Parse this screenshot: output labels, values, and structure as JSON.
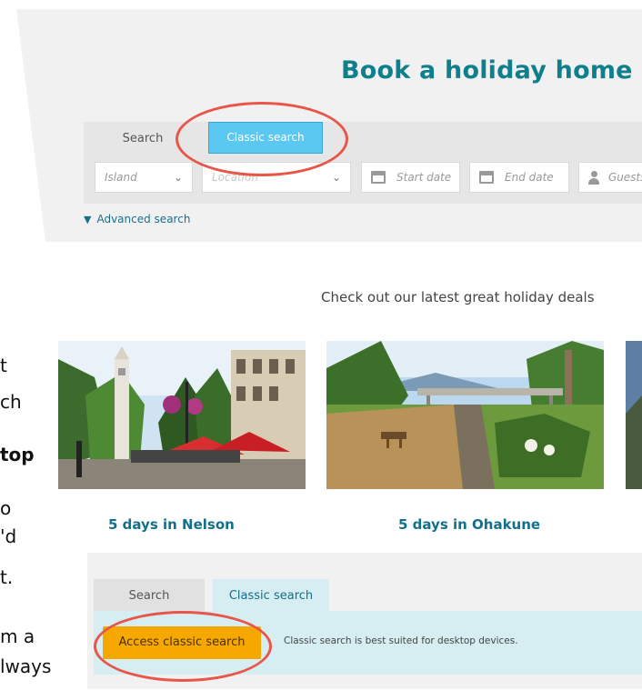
{
  "side_text": {
    "lines": [
      "t",
      "ch",
      "top",
      "o",
      "'d",
      "t.",
      "m a",
      "lways"
    ]
  },
  "header": {
    "title": "Book a holiday home"
  },
  "search": {
    "tabs": {
      "search": "Search",
      "classic": "Classic search"
    },
    "fields": {
      "island": "Island",
      "location": "Location",
      "start_date": "Start date",
      "end_date": "End date",
      "guests": "Guests"
    },
    "advanced_label": "Advanced search"
  },
  "deals": {
    "heading": "Check out our latest great holiday deals",
    "items": [
      {
        "caption": "5 days in Nelson"
      },
      {
        "caption": "5 days in Ohakune"
      }
    ]
  },
  "classic_panel": {
    "tabs": {
      "search": "Search",
      "classic": "Classic search"
    },
    "button_label": "Access classic search",
    "note": "Classic search is best suited for desktop devices."
  },
  "colors": {
    "title_teal": "#0f7f8c",
    "classic_tab_blue": "#5ac8f0",
    "access_button_orange": "#f6a800",
    "annotation_red": "#e8564a"
  }
}
